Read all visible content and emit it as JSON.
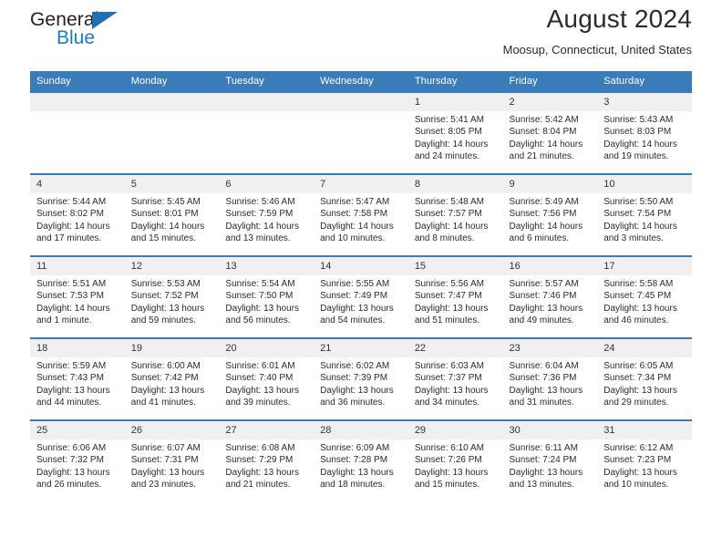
{
  "brand": {
    "name_primary": "General",
    "name_secondary": "Blue"
  },
  "header": {
    "title": "August 2024",
    "subtitle": "Moosup, Connecticut, United States",
    "accent_color": "#3a7cb9",
    "daynum_bg": "#f0f0f0"
  },
  "weekday_headers": [
    "Sunday",
    "Monday",
    "Tuesday",
    "Wednesday",
    "Thursday",
    "Friday",
    "Saturday"
  ],
  "weeks": [
    [
      {
        "empty": true,
        "day": ""
      },
      {
        "empty": true,
        "day": ""
      },
      {
        "empty": true,
        "day": ""
      },
      {
        "empty": true,
        "day": ""
      },
      {
        "day": "1",
        "sunrise": "Sunrise: 5:41 AM",
        "sunset": "Sunset: 8:05 PM",
        "daylight": "Daylight: 14 hours and 24 minutes."
      },
      {
        "day": "2",
        "sunrise": "Sunrise: 5:42 AM",
        "sunset": "Sunset: 8:04 PM",
        "daylight": "Daylight: 14 hours and 21 minutes."
      },
      {
        "day": "3",
        "sunrise": "Sunrise: 5:43 AM",
        "sunset": "Sunset: 8:03 PM",
        "daylight": "Daylight: 14 hours and 19 minutes."
      }
    ],
    [
      {
        "day": "4",
        "sunrise": "Sunrise: 5:44 AM",
        "sunset": "Sunset: 8:02 PM",
        "daylight": "Daylight: 14 hours and 17 minutes."
      },
      {
        "day": "5",
        "sunrise": "Sunrise: 5:45 AM",
        "sunset": "Sunset: 8:01 PM",
        "daylight": "Daylight: 14 hours and 15 minutes."
      },
      {
        "day": "6",
        "sunrise": "Sunrise: 5:46 AM",
        "sunset": "Sunset: 7:59 PM",
        "daylight": "Daylight: 14 hours and 13 minutes."
      },
      {
        "day": "7",
        "sunrise": "Sunrise: 5:47 AM",
        "sunset": "Sunset: 7:58 PM",
        "daylight": "Daylight: 14 hours and 10 minutes."
      },
      {
        "day": "8",
        "sunrise": "Sunrise: 5:48 AM",
        "sunset": "Sunset: 7:57 PM",
        "daylight": "Daylight: 14 hours and 8 minutes."
      },
      {
        "day": "9",
        "sunrise": "Sunrise: 5:49 AM",
        "sunset": "Sunset: 7:56 PM",
        "daylight": "Daylight: 14 hours and 6 minutes."
      },
      {
        "day": "10",
        "sunrise": "Sunrise: 5:50 AM",
        "sunset": "Sunset: 7:54 PM",
        "daylight": "Daylight: 14 hours and 3 minutes."
      }
    ],
    [
      {
        "day": "11",
        "sunrise": "Sunrise: 5:51 AM",
        "sunset": "Sunset: 7:53 PM",
        "daylight": "Daylight: 14 hours and 1 minute."
      },
      {
        "day": "12",
        "sunrise": "Sunrise: 5:53 AM",
        "sunset": "Sunset: 7:52 PM",
        "daylight": "Daylight: 13 hours and 59 minutes."
      },
      {
        "day": "13",
        "sunrise": "Sunrise: 5:54 AM",
        "sunset": "Sunset: 7:50 PM",
        "daylight": "Daylight: 13 hours and 56 minutes."
      },
      {
        "day": "14",
        "sunrise": "Sunrise: 5:55 AM",
        "sunset": "Sunset: 7:49 PM",
        "daylight": "Daylight: 13 hours and 54 minutes."
      },
      {
        "day": "15",
        "sunrise": "Sunrise: 5:56 AM",
        "sunset": "Sunset: 7:47 PM",
        "daylight": "Daylight: 13 hours and 51 minutes."
      },
      {
        "day": "16",
        "sunrise": "Sunrise: 5:57 AM",
        "sunset": "Sunset: 7:46 PM",
        "daylight": "Daylight: 13 hours and 49 minutes."
      },
      {
        "day": "17",
        "sunrise": "Sunrise: 5:58 AM",
        "sunset": "Sunset: 7:45 PM",
        "daylight": "Daylight: 13 hours and 46 minutes."
      }
    ],
    [
      {
        "day": "18",
        "sunrise": "Sunrise: 5:59 AM",
        "sunset": "Sunset: 7:43 PM",
        "daylight": "Daylight: 13 hours and 44 minutes."
      },
      {
        "day": "19",
        "sunrise": "Sunrise: 6:00 AM",
        "sunset": "Sunset: 7:42 PM",
        "daylight": "Daylight: 13 hours and 41 minutes."
      },
      {
        "day": "20",
        "sunrise": "Sunrise: 6:01 AM",
        "sunset": "Sunset: 7:40 PM",
        "daylight": "Daylight: 13 hours and 39 minutes."
      },
      {
        "day": "21",
        "sunrise": "Sunrise: 6:02 AM",
        "sunset": "Sunset: 7:39 PM",
        "daylight": "Daylight: 13 hours and 36 minutes."
      },
      {
        "day": "22",
        "sunrise": "Sunrise: 6:03 AM",
        "sunset": "Sunset: 7:37 PM",
        "daylight": "Daylight: 13 hours and 34 minutes."
      },
      {
        "day": "23",
        "sunrise": "Sunrise: 6:04 AM",
        "sunset": "Sunset: 7:36 PM",
        "daylight": "Daylight: 13 hours and 31 minutes."
      },
      {
        "day": "24",
        "sunrise": "Sunrise: 6:05 AM",
        "sunset": "Sunset: 7:34 PM",
        "daylight": "Daylight: 13 hours and 29 minutes."
      }
    ],
    [
      {
        "day": "25",
        "sunrise": "Sunrise: 6:06 AM",
        "sunset": "Sunset: 7:32 PM",
        "daylight": "Daylight: 13 hours and 26 minutes."
      },
      {
        "day": "26",
        "sunrise": "Sunrise: 6:07 AM",
        "sunset": "Sunset: 7:31 PM",
        "daylight": "Daylight: 13 hours and 23 minutes."
      },
      {
        "day": "27",
        "sunrise": "Sunrise: 6:08 AM",
        "sunset": "Sunset: 7:29 PM",
        "daylight": "Daylight: 13 hours and 21 minutes."
      },
      {
        "day": "28",
        "sunrise": "Sunrise: 6:09 AM",
        "sunset": "Sunset: 7:28 PM",
        "daylight": "Daylight: 13 hours and 18 minutes."
      },
      {
        "day": "29",
        "sunrise": "Sunrise: 6:10 AM",
        "sunset": "Sunset: 7:26 PM",
        "daylight": "Daylight: 13 hours and 15 minutes."
      },
      {
        "day": "30",
        "sunrise": "Sunrise: 6:11 AM",
        "sunset": "Sunset: 7:24 PM",
        "daylight": "Daylight: 13 hours and 13 minutes."
      },
      {
        "day": "31",
        "sunrise": "Sunrise: 6:12 AM",
        "sunset": "Sunset: 7:23 PM",
        "daylight": "Daylight: 13 hours and 10 minutes."
      }
    ]
  ]
}
